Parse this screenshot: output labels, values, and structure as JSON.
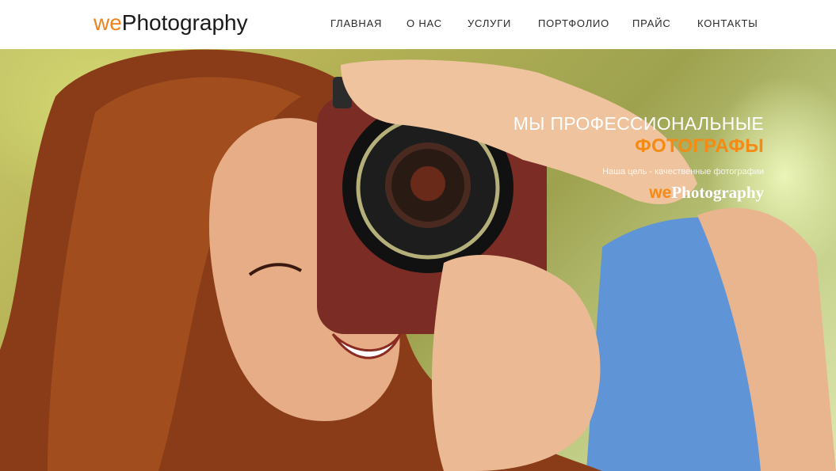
{
  "header": {
    "logo": {
      "prefix": "we",
      "main": "Photography"
    },
    "nav": [
      {
        "label": "ГЛАВНАЯ"
      },
      {
        "label": "О НАС"
      },
      {
        "label": "УСЛУГИ"
      },
      {
        "label": "ПОРТФОЛИО"
      },
      {
        "label": "ПРАЙС"
      },
      {
        "label": "КОНТАКТЫ"
      }
    ]
  },
  "hero": {
    "title_line1": "МЫ ПРОФЕССИОНАЛЬНЫЕ",
    "title_line2": "ФОТОГРАФЫ",
    "subtitle": "Наша цель - качественные фотографии",
    "logo": {
      "prefix": "we",
      "main": "Photography"
    }
  },
  "colors": {
    "accent": "#f58a14",
    "nav_text": "#2a2a2a",
    "header_bg": "#ffffff"
  }
}
